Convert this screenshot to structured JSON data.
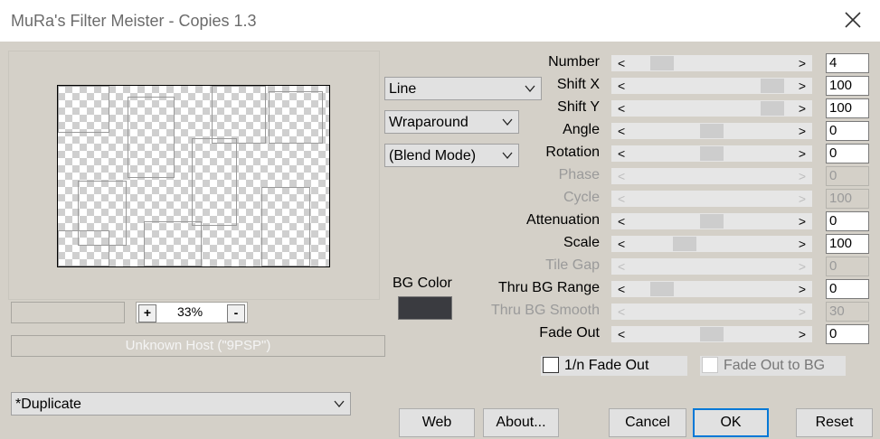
{
  "window": {
    "title": "MuRa's Filter Meister - Copies 1.3"
  },
  "zoom": {
    "plus": "+",
    "value": "33%",
    "minus": "-"
  },
  "host": "Unknown Host (\"9PSP\")",
  "combos": {
    "mode": "Line",
    "wrap": "Wraparound",
    "blend": "(Blend Mode)",
    "preset": "*Duplicate"
  },
  "bg_color": {
    "label": "BG Color",
    "value": "#3a3b40"
  },
  "params": [
    {
      "label": "Number",
      "value": "4",
      "enabled": true,
      "position": 0.13
    },
    {
      "label": "Shift X",
      "value": "100",
      "enabled": true,
      "position": 0.95
    },
    {
      "label": "Shift Y",
      "value": "100",
      "enabled": true,
      "position": 0.95
    },
    {
      "label": "Angle",
      "value": "0",
      "enabled": true,
      "position": 0.5
    },
    {
      "label": "Rotation",
      "value": "0",
      "enabled": true,
      "position": 0.5
    },
    {
      "label": "Phase",
      "value": "0",
      "enabled": false
    },
    {
      "label": "Cycle",
      "value": "100",
      "enabled": false
    },
    {
      "label": "Attenuation",
      "value": "0",
      "enabled": true,
      "position": 0.5
    },
    {
      "label": "Scale",
      "value": "100",
      "enabled": true,
      "position": 0.3
    },
    {
      "label": "Tile Gap",
      "value": "0",
      "enabled": false
    },
    {
      "label": "Thru BG Range",
      "value": "0",
      "enabled": true,
      "position": 0.13
    },
    {
      "label": "Thru BG Smooth",
      "value": "30",
      "enabled": false
    },
    {
      "label": "Fade Out",
      "value": "0",
      "enabled": true,
      "position": 0.5
    }
  ],
  "checks": {
    "fade_inv": "1/n Fade Out",
    "fade_bg": "Fade Out to BG"
  },
  "buttons": {
    "web": "Web",
    "about": "About...",
    "cancel": "Cancel",
    "ok": "OK",
    "reset": "Reset"
  },
  "colors": {
    "accent": "#0078d7",
    "dialog_bg": "#d4d0c8"
  }
}
